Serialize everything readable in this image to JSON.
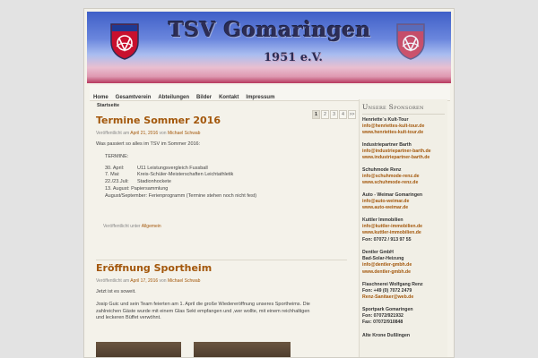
{
  "header": {
    "title": "TSV Gomaringen",
    "year": "1951 e.V.",
    "crest_label": "Gomaringen"
  },
  "nav": {
    "items": [
      "Home",
      "Gesamtverein",
      "Abteilungen",
      "Bilder",
      "Kontakt",
      "Impressum"
    ]
  },
  "breadcrumb": "Startseite",
  "pager": {
    "pages": [
      "1",
      "2",
      "3",
      "4",
      ">>"
    ],
    "current": "1"
  },
  "posts": [
    {
      "title": "Termine Sommer 2016",
      "meta_prefix": "Veröffentlicht am",
      "date": "April 21, 2016",
      "meta_by": "von",
      "author": "Michael Schwab",
      "intro": "Was passiert so alles im TSV im Sommer 2016:",
      "list_label": "TERMINE:",
      "terms": [
        {
          "date": "30. April:",
          "text": "U11 Leistungsvergleich Fussball"
        },
        {
          "date": "7. Mai:",
          "text": "Kreis-Schüler-Meisterschaften Leichtathletik"
        },
        {
          "date": "22./23.Juli:",
          "text": "Stadionhockete"
        },
        {
          "date": "13. August:",
          "text": "Papiersammlung"
        },
        {
          "date": "August/September:",
          "text": "Ferienprogramm (Termine stehen noch nicht fest)"
        }
      ],
      "footer_prefix": "Veröffentlicht unter",
      "category": "Allgemein"
    },
    {
      "title": "Eröffnung Sportheim",
      "meta_prefix": "Veröffentlicht am",
      "date": "April 17, 2016",
      "meta_by": "von",
      "author": "Michael Schwab",
      "p1": "Jetzt ist es soweit.",
      "p2a": "Josip Guic und sein Team feierten am 1. April die große Wiedereröffnung unseres Sportheims. Die",
      "p2b": "zahlreichen Gäste wurde mit einem Glas Sekt empfangen und ,wer wollte, mit einem reichhaltigen",
      "p2c": "und leckeren Büffet verwöhnt."
    }
  ],
  "sidebar": {
    "title": "Unsere Sponsoren",
    "sponsors": [
      {
        "name": "Henriette´s Kult-Tour",
        "lines": [],
        "links": [
          "info@henriettes-kult-tour.de",
          "www.henriettes-kult-tour.de"
        ],
        "fon": ""
      },
      {
        "name": "Industriepartner Barth",
        "lines": [],
        "links": [
          "info@industriepartner-barth.de",
          "www.industriepartner-barth.de"
        ],
        "fon": ""
      },
      {
        "name": "Schuhmode Renz",
        "lines": [],
        "links": [
          "info@schuhmode-renz.de",
          "www.schuhmode-renz.de"
        ],
        "fon": ""
      },
      {
        "name": "Auto - Weimar Gomaringen",
        "lines": [],
        "links": [
          "info@auto-weimar.de",
          "www.auto-weimar.de"
        ],
        "fon": ""
      },
      {
        "name": "Kuttler Immobilien",
        "lines": [],
        "links": [
          "info@kuttler-immobilien.de",
          "www.kuttler-immobilien.de"
        ],
        "fon": "Fon: 07072 / 913 97 55"
      },
      {
        "name": "Dentler GmbH",
        "lines": [
          "Bad-Solar-Heizung"
        ],
        "links": [
          "info@dentler-gmbh.de",
          "www.dentler-gmbh.de"
        ],
        "fon": ""
      },
      {
        "name": "Flaschnerei Wolfgang Renz",
        "lines": [
          "Fon: +49 (0) 7072 2479"
        ],
        "links": [
          "Renz-Sanitaer@web.de"
        ],
        "fon": ""
      },
      {
        "name": "Sportpark Gomaringen",
        "lines": [
          "Fon: 07072/921932",
          "Fax: 07072/910848"
        ],
        "links": [],
        "fon": ""
      },
      {
        "name": "Alte Krone Dußlingen",
        "lines": [],
        "links": [],
        "fon": ""
      }
    ]
  }
}
